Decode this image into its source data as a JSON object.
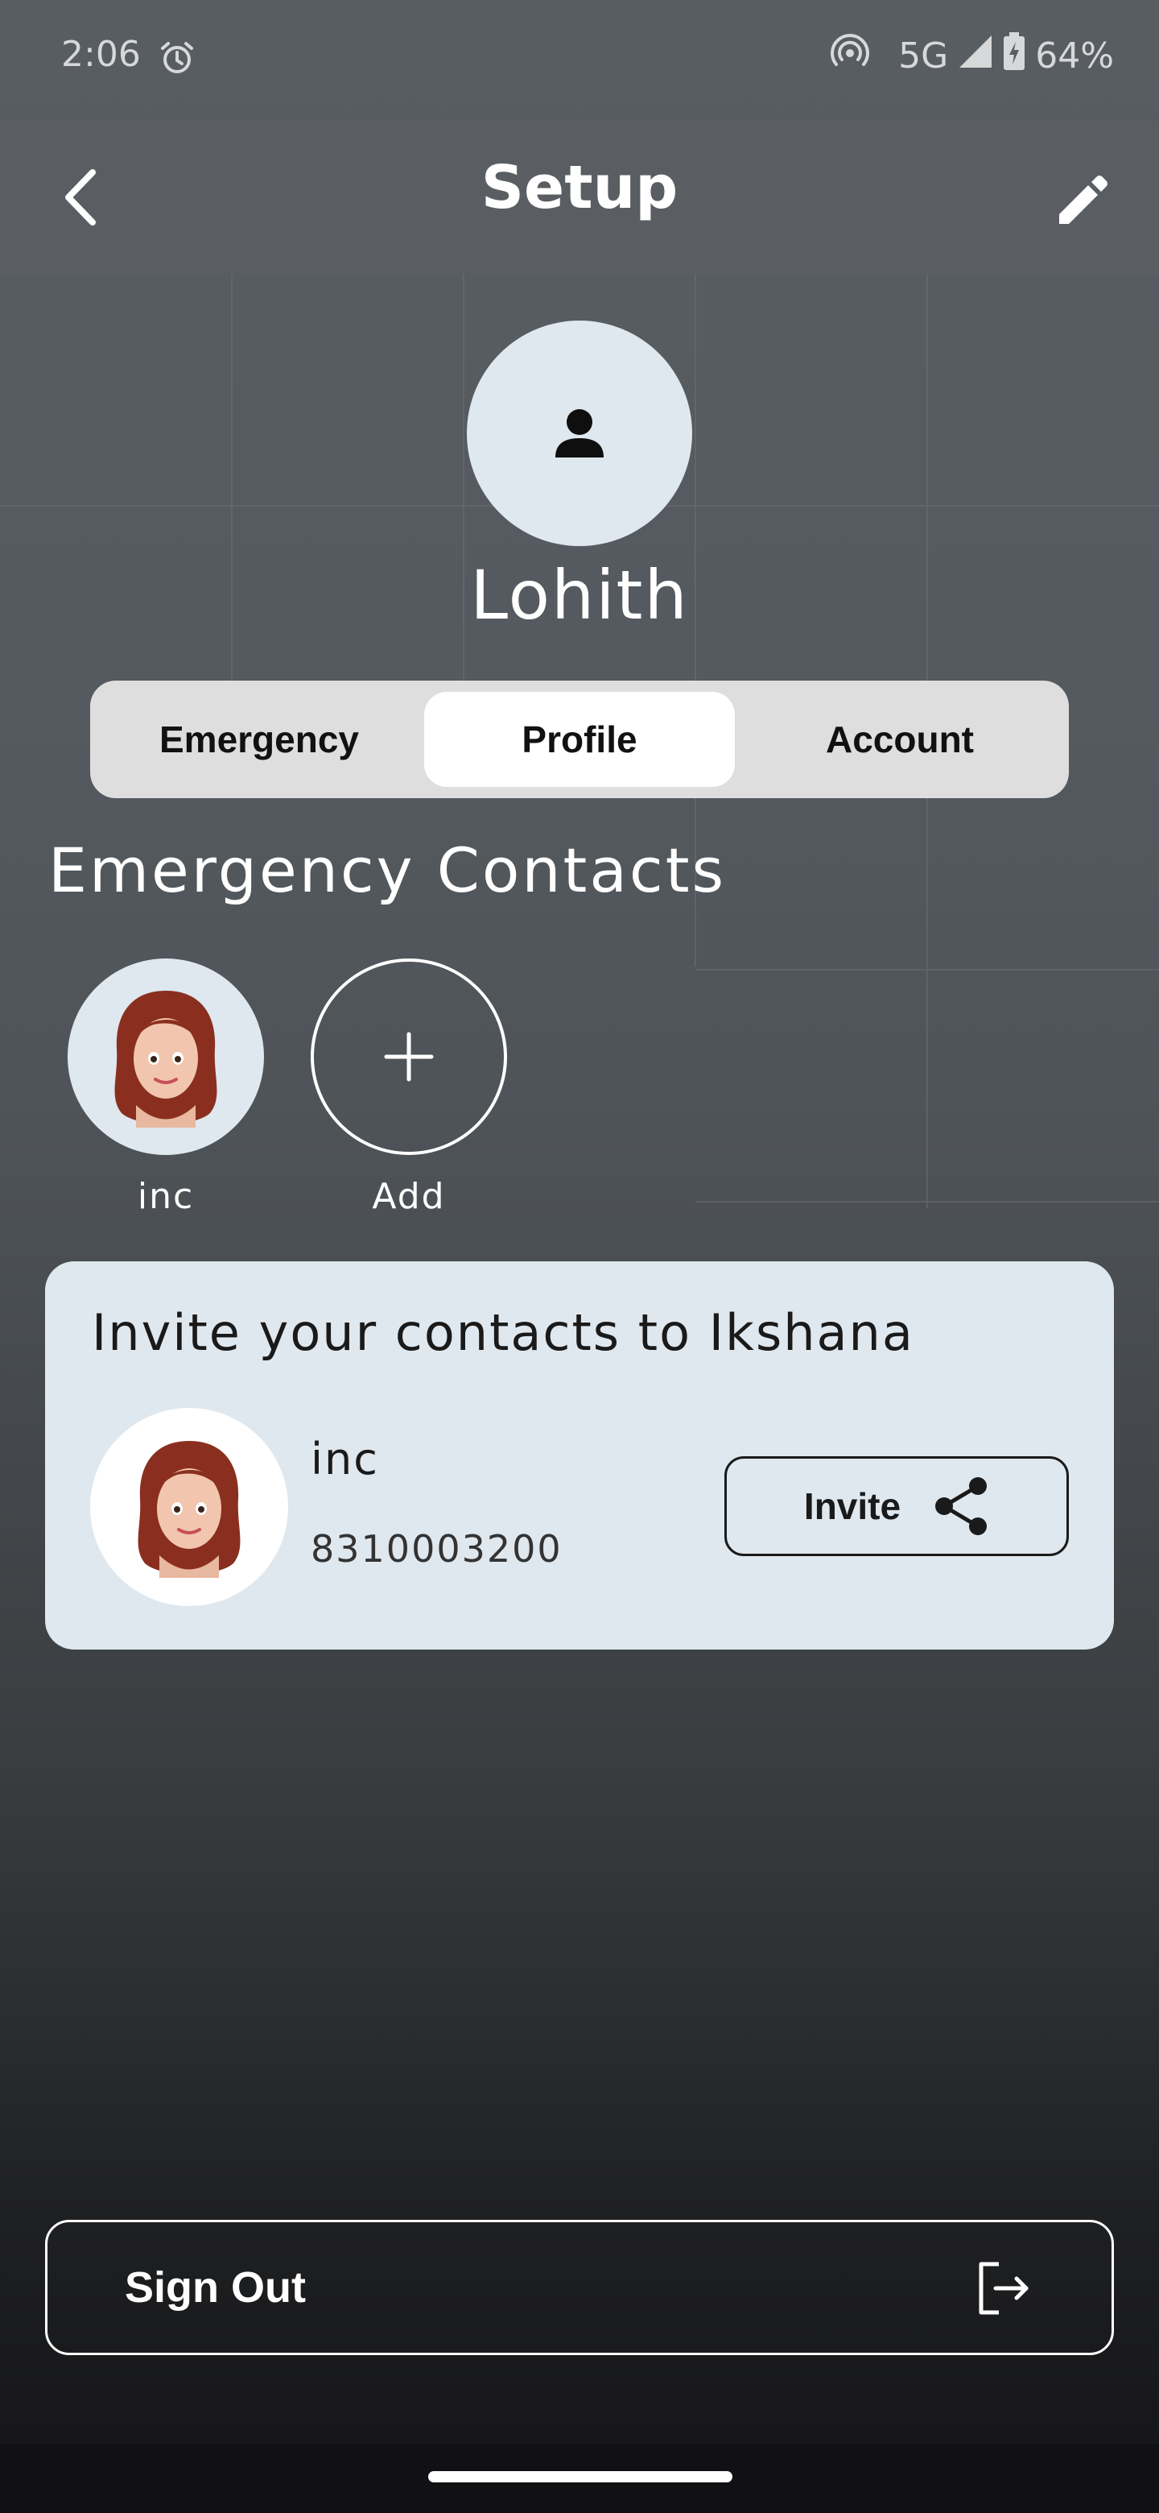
{
  "status_bar": {
    "time": "2:06",
    "network": "5G",
    "battery": "64%",
    "icons": [
      "alarm-icon",
      "hotspot-icon",
      "signal-icon",
      "battery-icon"
    ]
  },
  "header": {
    "title": "Setup",
    "back_icon": "chevron-left-icon",
    "edit_icon": "pencil-icon"
  },
  "profile": {
    "name": "Lohith",
    "avatar_icon": "person-icon"
  },
  "tabs": [
    {
      "label": "Emergency",
      "active": false
    },
    {
      "label": "Profile",
      "active": true
    },
    {
      "label": "Account",
      "active": false
    }
  ],
  "emergency_contacts": {
    "title": "Emergency Contacts",
    "contacts": [
      {
        "label": "inc",
        "icon": "female-avatar-icon"
      }
    ],
    "add_label": "Add",
    "add_icon": "plus-icon"
  },
  "invite_card": {
    "title": "Invite your contacts to Ikshana",
    "contact_name": "inc",
    "contact_phone": "8310003200",
    "button_label": "Invite",
    "button_icon": "share-icon"
  },
  "sign_out": {
    "label": "Sign Out",
    "icon": "logout-icon"
  },
  "colors": {
    "card_background": "#dfe8ee",
    "tab_bar_background": "#dedede",
    "header_background": "#5a5e63"
  }
}
